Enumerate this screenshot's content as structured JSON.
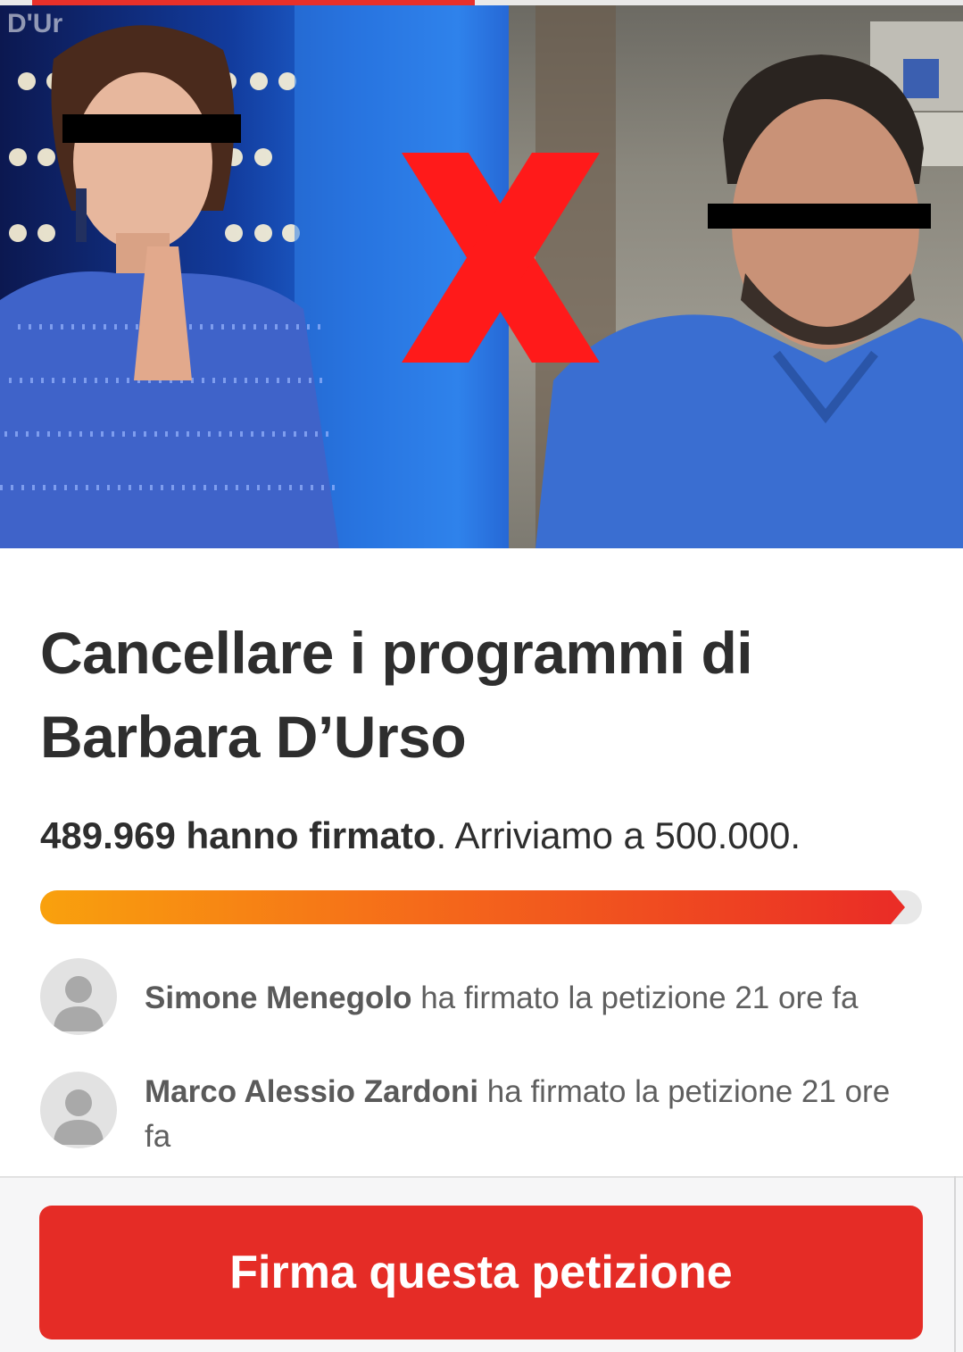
{
  "hero": {
    "watermark": "D'Ur"
  },
  "petition": {
    "title": "Cancellare i programmi di Barbara D’Urso",
    "signed_count": "489.969 hanno firmato",
    "goal_text": ". Arriviamo a 500.000.",
    "progress_fraction": 0.98
  },
  "recent_signers": [
    {
      "name": "Simone Menegolo",
      "action": " ha firmato la petizione 21 ore fa"
    },
    {
      "name": "Marco Alessio Zardoni",
      "action": " ha firmato la petizione 21 ore fa"
    }
  ],
  "cta": {
    "label": "Firma questa petizione"
  },
  "colors": {
    "accent": "#e52c26",
    "progress_start": "#f9a10d",
    "progress_end": "#ea2d26",
    "text": "#2e2e2e"
  },
  "icons": {
    "avatar": "default-user-avatar-icon"
  }
}
